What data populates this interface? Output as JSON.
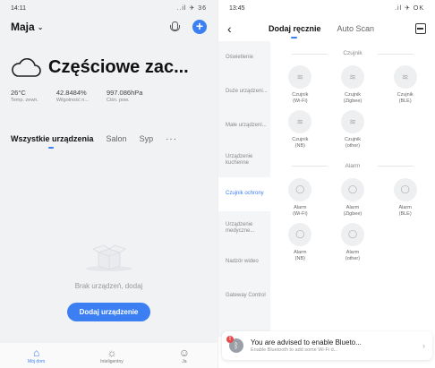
{
  "left": {
    "status": {
      "time": "14:11",
      "icons": "..il ✈ 36"
    },
    "home": {
      "name": "Maja"
    },
    "weather": {
      "title": "Częściowe zac...",
      "stats": [
        {
          "value": "26°C",
          "label": "Temp. zewn."
        },
        {
          "value": "42.8484%",
          "label": "Wilgotność n..."
        },
        {
          "value": "997.086hPa",
          "label": "Ciśn. pow."
        }
      ]
    },
    "tabs": [
      "Wszystkie urządzenia",
      "Salon",
      "Syp"
    ],
    "empty": {
      "text": "Brak urządzeń, dodaj",
      "button": "Dodaj urządzenie"
    },
    "nav": [
      {
        "label": "Mój dom",
        "icon": "home-icon"
      },
      {
        "label": "Inteligentny",
        "icon": "sun-icon"
      },
      {
        "label": "Ja",
        "icon": "profile-icon"
      }
    ]
  },
  "right": {
    "status": {
      "time": "13:45",
      "icons": ".il ✈ OK"
    },
    "tabs": {
      "manual": "Dodaj ręcznie",
      "auto": "Auto Scan"
    },
    "categories": [
      "Oświetlenie",
      "Duże urządzeni...",
      "Małe urządzeni...",
      "Urządzenie kuchenne",
      "Czujnik ochrony",
      "Urządzenie medyczne...",
      "Nadzór wideo",
      "Gateway Control"
    ],
    "sections": [
      {
        "title": "Czujnik",
        "devices": [
          {
            "name": "Czujnik",
            "sub": "(Wi-Fi)"
          },
          {
            "name": "Czujnik",
            "sub": "(Zigbee)"
          },
          {
            "name": "Czujnik",
            "sub": "(BLE)"
          },
          {
            "name": "Czujnik",
            "sub": "(NB)"
          },
          {
            "name": "Czujnik",
            "sub": "(other)"
          }
        ]
      },
      {
        "title": "Alarm",
        "devices": [
          {
            "name": "Alarm",
            "sub": "(Wi-Fi)"
          },
          {
            "name": "Alarm",
            "sub": "(Zigbee)"
          },
          {
            "name": "Alarm",
            "sub": "(BLE)"
          },
          {
            "name": "Alarm",
            "sub": "(NB)"
          },
          {
            "name": "Alarm",
            "sub": "(other)"
          }
        ]
      }
    ],
    "toast": {
      "badge": "!",
      "title": "You are advised to enable Blueto...",
      "subtitle": "Enable Bluetooth to add some Wi-Fi d..."
    }
  },
  "colors": {
    "accent": "#3b7ff3",
    "badge": "#e54a4a"
  }
}
